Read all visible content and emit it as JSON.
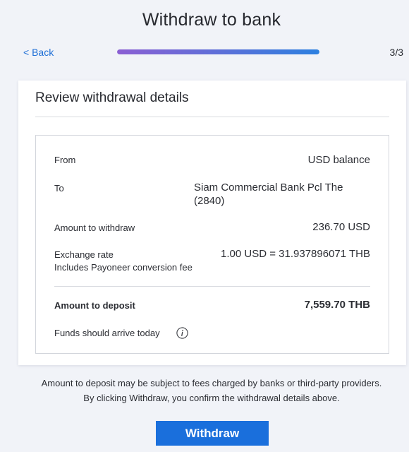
{
  "header": {
    "title": "Withdraw to bank",
    "back_label": "< Back",
    "step": "3/3",
    "progress": 1.0
  },
  "review": {
    "title": "Review withdrawal details",
    "from_label": "From",
    "from_value": "USD balance",
    "to_label": "To",
    "to_value": "Siam Commercial Bank Pcl The (2840)",
    "amount_label": "Amount to withdraw",
    "amount_value": "236.70 USD",
    "rate_label": "Exchange rate",
    "rate_sublabel": "Includes Payoneer conversion fee",
    "rate_value": "1.00 USD = 31.937896071 THB",
    "deposit_label": "Amount to deposit",
    "deposit_value": "7,559.70 THB",
    "arrival_label": "Funds should arrive today",
    "info_icon": "info-icon"
  },
  "footer": {
    "disclaimer_line1": "Amount to deposit may be subject to fees charged by banks or third-party providers.",
    "disclaimer_line2": "By clicking Withdraw, you confirm the withdrawal details above.",
    "withdraw_label": "Withdraw"
  },
  "colors": {
    "accent": "#1a6fdc",
    "progress_start": "#8b5fd3",
    "progress_end": "#2c80e0",
    "background": "#f1f3f8"
  }
}
